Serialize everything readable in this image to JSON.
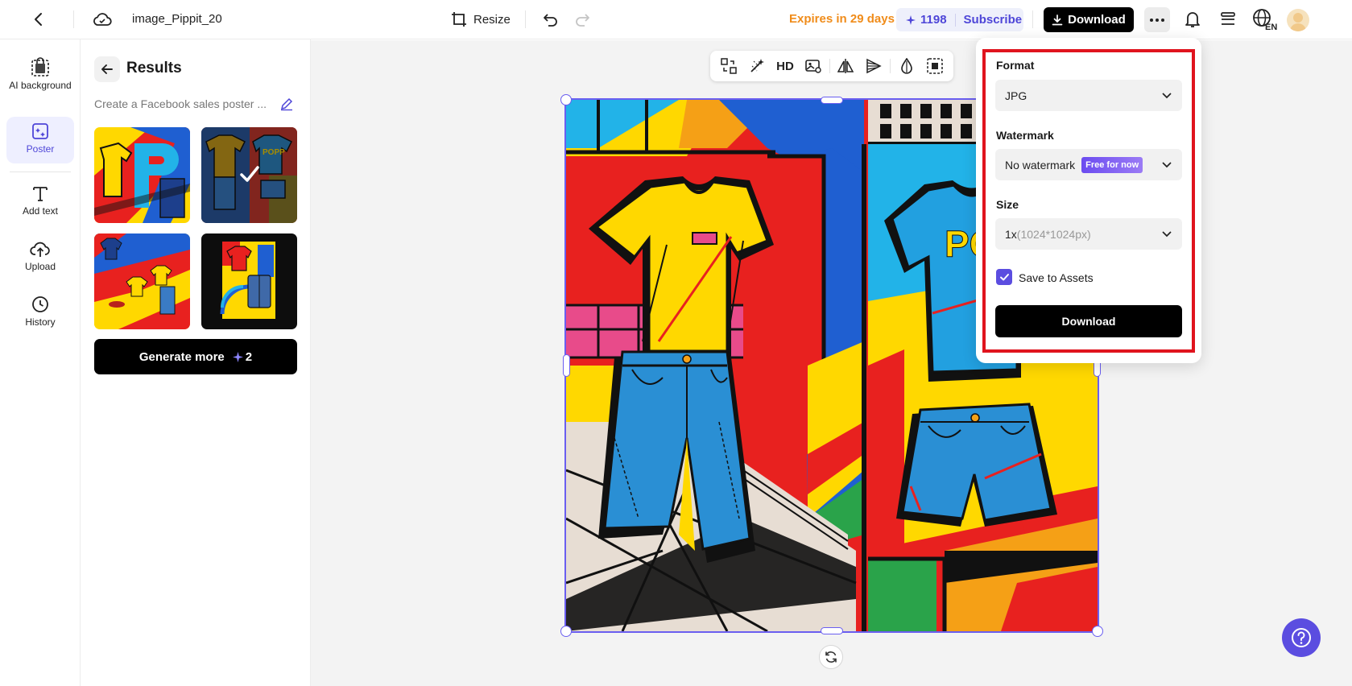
{
  "header": {
    "title": "image_Pippit_20",
    "resize_label": "Resize",
    "expires": "Expires in 29 days",
    "credits": "1198",
    "subscribe_label": "Subscribe",
    "download_label": "Download",
    "lang_code": "EN"
  },
  "rail": {
    "items": [
      {
        "label": "AI background",
        "icon": "ai-background-icon"
      },
      {
        "label": "Poster",
        "icon": "poster-icon",
        "active": true
      },
      {
        "label": "Add text",
        "icon": "text-icon"
      },
      {
        "label": "Upload",
        "icon": "upload-icon"
      },
      {
        "label": "History",
        "icon": "history-icon"
      }
    ]
  },
  "panel": {
    "title": "Results",
    "prompt": "Create a Facebook sales poster ...",
    "generate_label": "Generate more",
    "generate_cost": "2",
    "thumbnails": [
      {
        "name": "result-1"
      },
      {
        "name": "result-2",
        "selected": true,
        "text": "POPP"
      },
      {
        "name": "result-3"
      },
      {
        "name": "result-4"
      }
    ]
  },
  "toolbar": {
    "hd_label": "HD"
  },
  "poster": {
    "text": "PO"
  },
  "download_panel": {
    "format_label": "Format",
    "format_value": "JPG",
    "watermark_label": "Watermark",
    "watermark_value": "No watermark",
    "watermark_badge": "Free for now",
    "size_label": "Size",
    "size_value": "1x",
    "size_dims": "(1024*1024px)",
    "save_assets_label": "Save to Assets",
    "save_assets_checked": true,
    "download_label": "Download"
  },
  "colors": {
    "accent": "#5b4de0",
    "expires": "#f08c1a",
    "highlight": "#e0141e"
  }
}
